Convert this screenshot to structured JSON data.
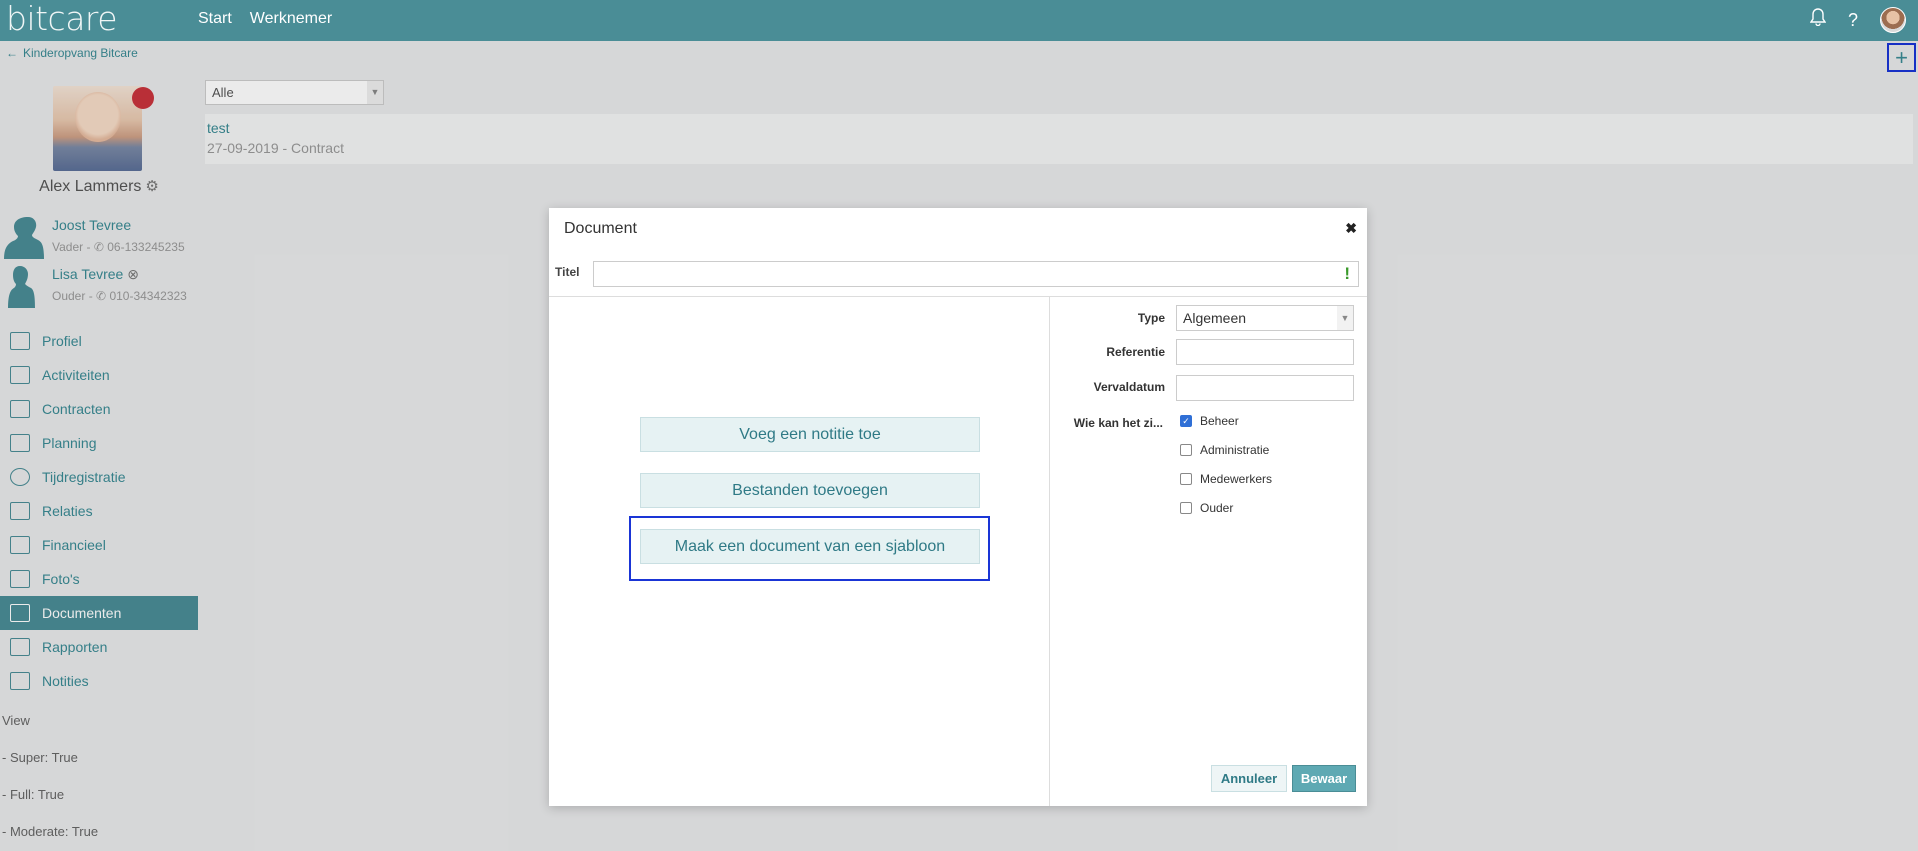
{
  "header": {
    "logo": "bitcare",
    "nav": [
      "Start",
      "Werknemer"
    ],
    "icons": [
      "bell-icon",
      "help-icon",
      "user-avatar"
    ],
    "color": "#4a8d96"
  },
  "sidebar": {
    "back_label": "Kinderopvang Bitcare",
    "child_name": "Alex Lammers",
    "relations": [
      {
        "name": "Joost Tevree",
        "role": "Vader",
        "phone": "06-133245235"
      },
      {
        "name": "Lisa Tevree",
        "role": "Ouder",
        "phone": "010-34342323"
      }
    ],
    "menu": [
      {
        "label": "Profiel",
        "icon": "profile-card-icon"
      },
      {
        "label": "Activiteiten",
        "icon": "table-icon"
      },
      {
        "label": "Contracten",
        "icon": "contract-icon"
      },
      {
        "label": "Planning",
        "icon": "calendar-icon"
      },
      {
        "label": "Tijdregistratie",
        "icon": "stopwatch-icon"
      },
      {
        "label": "Relaties",
        "icon": "people-icon"
      },
      {
        "label": "Financieel",
        "icon": "bar-chart-icon"
      },
      {
        "label": "Foto's",
        "icon": "camera-icon"
      },
      {
        "label": "Documenten",
        "icon": "folder-icon",
        "active": true
      },
      {
        "label": "Rapporten",
        "icon": "report-icon"
      },
      {
        "label": "Notities",
        "icon": "clipboard-icon"
      }
    ],
    "debug": [
      "View",
      "- Super: True",
      "- Full: True",
      "- Moderate: True"
    ]
  },
  "main": {
    "filter_value": "Alle",
    "documents": [
      {
        "title": "test",
        "subtitle": "27-09-2019 - Contract"
      }
    ]
  },
  "modal": {
    "title": "Document",
    "title_label": "Titel",
    "title_value": "",
    "actions": [
      "Voeg een notitie toe",
      "Bestanden toevoegen",
      "Maak een document van een sjabloon"
    ],
    "fields": {
      "type_label": "Type",
      "type_value": "Algemeen",
      "referentie_label": "Referentie",
      "vervaldatum_label": "Vervaldatum",
      "visibility_label": "Wie kan het zi..."
    },
    "visibility": [
      {
        "label": "Beheer",
        "checked": true
      },
      {
        "label": "Administratie",
        "checked": false
      },
      {
        "label": "Medewerkers",
        "checked": false
      },
      {
        "label": "Ouder",
        "checked": false
      }
    ],
    "cancel_label": "Annuleer",
    "save_label": "Bewaar"
  }
}
